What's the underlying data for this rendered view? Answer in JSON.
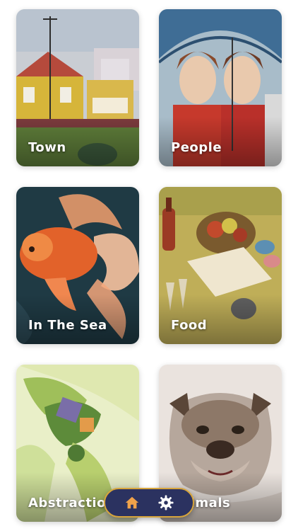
{
  "categories": [
    {
      "label": "Town",
      "icon": "town-painting"
    },
    {
      "label": "People",
      "icon": "people-painting"
    },
    {
      "label": "In The Sea",
      "icon": "goldfish-painting"
    },
    {
      "label": "Food",
      "icon": "still-life-painting"
    },
    {
      "label": "Abstraction",
      "icon": "abstract-painting"
    },
    {
      "label": "Animals",
      "icon": "bulldog-painting"
    }
  ],
  "nav": {
    "home_icon": "home-icon",
    "settings_icon": "gear-icon"
  },
  "colors": {
    "nav_bg": "#2b3260",
    "nav_border": "#d7a53c",
    "icon_accent": "#f0a24a"
  }
}
